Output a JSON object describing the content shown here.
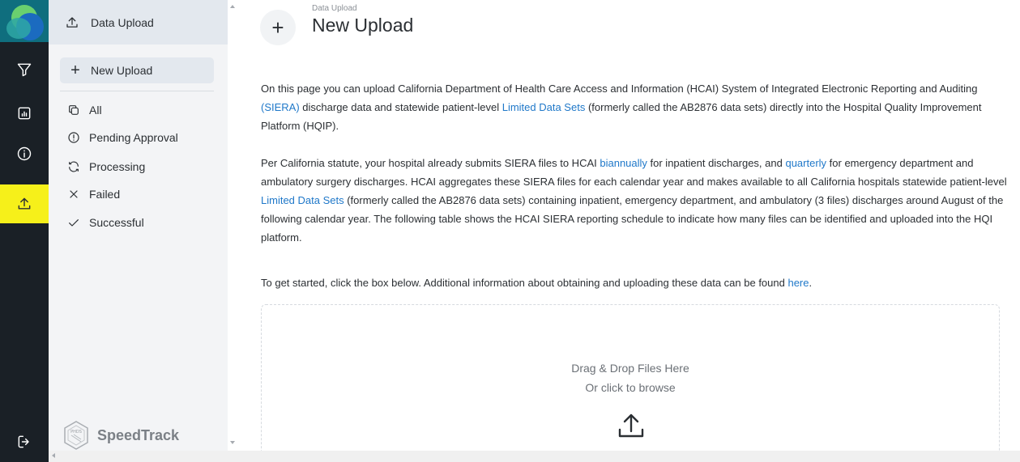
{
  "rail": {
    "items": [
      {
        "name": "filter-icon"
      },
      {
        "name": "chart-icon"
      },
      {
        "name": "info-icon"
      },
      {
        "name": "upload-icon",
        "active": true
      },
      {
        "name": "logout-icon"
      }
    ],
    "active_color": "#f6f01a"
  },
  "sidebar": {
    "header": "Data Upload",
    "new_upload": "New Upload",
    "items": [
      {
        "label": "All",
        "icon": "copy-icon"
      },
      {
        "label": "Pending Approval",
        "icon": "alert-circle-icon"
      },
      {
        "label": "Processing",
        "icon": "refresh-icon"
      },
      {
        "label": "Failed",
        "icon": "x-icon"
      },
      {
        "label": "Successful",
        "icon": "check-icon"
      }
    ],
    "brand_badge": "PHDS",
    "brand_name": "SpeedTrack"
  },
  "main": {
    "breadcrumb": "Data Upload",
    "title": "New Upload",
    "p1": {
      "a": "On this page you can upload California Department of Health Care Access and Information (HCAI) System of Integrated Electronic Reporting and Auditing ",
      "link1": "(SIERA)",
      "b": " discharge data and statewide patient-level ",
      "link2": "Limited Data Sets",
      "c": " (formerly called the AB2876 data sets) directly into the Hospital Quality Improvement Platform (HQIP)."
    },
    "p2": {
      "a": "Per California statute, your hospital already submits SIERA files to HCAI ",
      "link1": "biannually",
      "b": " for inpatient discharges, and ",
      "link2": "quarterly",
      "c": " for emergency department and ambulatory surgery discharges. HCAI aggregates these SIERA files for each calendar year and makes available to all California hospitals statewide patient-level ",
      "link3": "Limited Data Sets",
      "d": " (formerly called the AB2876 data sets) containing inpatient, emergency department, and ambulatory (3 files) discharges around August of the following calendar year. The following table shows the HCAI SIERA reporting schedule to indicate how many files can be identified and uploaded into the HQI platform."
    },
    "p3": {
      "a": "To get started, click the box below. Additional information about obtaining and uploading these data can be found ",
      "link1": "here",
      "b": "."
    },
    "dropzone": {
      "line1": "Drag & Drop Files Here",
      "line2": "Or click to browse"
    },
    "link_color": "#1f78c9"
  }
}
